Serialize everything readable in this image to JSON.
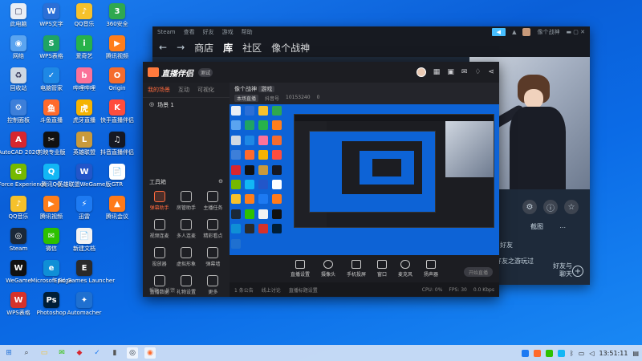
{
  "desktop": {
    "icons": [
      {
        "label": "此电脑",
        "col": 0,
        "row": 0,
        "color": "#e9eef5",
        "glyph": "▢"
      },
      {
        "label": "WPS文字",
        "col": 1,
        "row": 0,
        "color": "#2b6fd6",
        "glyph": "W"
      },
      {
        "label": "QQ音乐",
        "col": 2,
        "row": 0,
        "color": "#f6c12b",
        "glyph": "♪"
      },
      {
        "label": "360安全",
        "col": 3,
        "row": 0,
        "color": "#2fa84f",
        "glyph": "3"
      },
      {
        "label": "网络",
        "col": 0,
        "row": 1,
        "color": "#5aa4f0",
        "glyph": "◉"
      },
      {
        "label": "WPS表格",
        "col": 1,
        "row": 1,
        "color": "#1fa463",
        "glyph": "S"
      },
      {
        "label": "爱奇艺",
        "col": 2,
        "row": 1,
        "color": "#27b24a",
        "glyph": "i"
      },
      {
        "label": "腾讯视频",
        "col": 3,
        "row": 1,
        "color": "#ff7e1b",
        "glyph": "▶"
      },
      {
        "label": "回收站",
        "col": 0,
        "row": 2,
        "color": "#cfd8e3",
        "glyph": "♻"
      },
      {
        "label": "电脑管家",
        "col": 1,
        "row": 2,
        "color": "#1e88e5",
        "glyph": "✓"
      },
      {
        "label": "哔哩哔哩",
        "col": 2,
        "row": 2,
        "color": "#fb7299",
        "glyph": "b"
      },
      {
        "label": "Origin",
        "col": 3,
        "row": 2,
        "color": "#f56c2d",
        "glyph": "O"
      },
      {
        "label": "控制面板",
        "col": 0,
        "row": 3,
        "color": "#3d7fd9",
        "glyph": "⚙"
      },
      {
        "label": "斗鱼直播",
        "col": 1,
        "row": 3,
        "color": "#ff6a2b",
        "glyph": "鱼"
      },
      {
        "label": "虎牙直播",
        "col": 2,
        "row": 3,
        "color": "#f5b300",
        "glyph": "虎"
      },
      {
        "label": "快手直播伴侣",
        "col": 3,
        "row": 3,
        "color": "#ff4d3d",
        "glyph": "K"
      },
      {
        "label": "AutoCAD 2020",
        "col": 0,
        "row": 4,
        "color": "#d7262f",
        "glyph": "A"
      },
      {
        "label": "剪映专业版",
        "col": 1,
        "row": 4,
        "color": "#111111",
        "glyph": "✂"
      },
      {
        "label": "英雄联盟",
        "col": 2,
        "row": 4,
        "color": "#c99a3b",
        "glyph": "L"
      },
      {
        "label": "抖音直播伴侣",
        "col": 3,
        "row": 4,
        "color": "#161823",
        "glyph": "♫"
      },
      {
        "label": "GeForce Experience",
        "col": 0,
        "row": 5,
        "color": "#76b900",
        "glyph": "G"
      },
      {
        "label": "腾讯QQ",
        "col": 1,
        "row": 5,
        "color": "#12b7f5",
        "glyph": "Q"
      },
      {
        "label": "英雄联盟WeGame版",
        "col": 2,
        "row": 5,
        "color": "#2256c9",
        "glyph": "W"
      },
      {
        "label": "GTR",
        "col": 3,
        "row": 5,
        "color": "#ffffff",
        "glyph": "📄"
      },
      {
        "label": "QQ音乐",
        "col": 0,
        "row": 6,
        "color": "#f6c12b",
        "glyph": "♪"
      },
      {
        "label": "腾讯视频",
        "col": 1,
        "row": 6,
        "color": "#ff7e1b",
        "glyph": "▶"
      },
      {
        "label": "迅雷",
        "col": 2,
        "row": 6,
        "color": "#1d7af2",
        "glyph": "⚡"
      },
      {
        "label": "腾讯会议",
        "col": 3,
        "row": 6,
        "color": "#ff7a1a",
        "glyph": "▲"
      },
      {
        "label": "Steam",
        "col": 0,
        "row": 7,
        "color": "#1b2838",
        "glyph": "◎"
      },
      {
        "label": "微信",
        "col": 1,
        "row": 7,
        "color": "#2dc100",
        "glyph": "✉"
      },
      {
        "label": "新建文档",
        "col": 2,
        "row": 7,
        "color": "#f3f3f3",
        "glyph": "📄"
      },
      {
        "label": "WeGame",
        "col": 0,
        "row": 8,
        "color": "#111111",
        "glyph": "W"
      },
      {
        "label": "Microsoft Edge",
        "col": 1,
        "row": 8,
        "color": "#0f8fd6",
        "glyph": "e"
      },
      {
        "label": "Epic Games Launcher",
        "col": 2,
        "row": 8,
        "color": "#2a2a2a",
        "glyph": "E"
      },
      {
        "label": "WPS表格",
        "col": 0,
        "row": 9,
        "color": "#d6322a",
        "glyph": "W"
      },
      {
        "label": "Photoshop",
        "col": 1,
        "row": 9,
        "color": "#001e36",
        "glyph": "Ps"
      },
      {
        "label": "Automacher",
        "col": 2,
        "row": 9,
        "color": "#1f70d0",
        "glyph": "✦"
      }
    ]
  },
  "steam": {
    "top_items": [
      "Steam",
      "查看",
      "好友",
      "游戏",
      "帮助"
    ],
    "user_label": "像个战神",
    "nav": {
      "back": "←",
      "forward": "→",
      "store": "商店",
      "library": "库",
      "community": "社区",
      "profile": "像个战神"
    },
    "right_texts": {
      "friends_text": "好友",
      "activity": "好友之游玩过",
      "media": "截图",
      "more": "..."
    },
    "friends_chat": {
      "line1": "好友与",
      "line2": "聊天"
    }
  },
  "live": {
    "app_name": "直播伴侣",
    "version": "测试",
    "side_tabs": [
      "我的场景",
      "互动",
      "可视化"
    ],
    "scene": {
      "icon": "◎",
      "label": "场景 1"
    },
    "tools_title": "工具箱",
    "tools": [
      {
        "label": "弹幕助手",
        "hot": true
      },
      {
        "label": "房管助手",
        "hot": false
      },
      {
        "label": "主播任务",
        "hot": false
      },
      {
        "label": "视频连麦",
        "hot": false
      },
      {
        "label": "多人连麦",
        "hot": false
      },
      {
        "label": "精彩看点",
        "hot": false
      },
      {
        "label": "投放器",
        "hot": false
      },
      {
        "label": "虚拟形象",
        "hot": false
      },
      {
        "label": "弹幕墙",
        "hot": false
      },
      {
        "label": "直播数据",
        "hot": false
      },
      {
        "label": "礼物设置",
        "hot": false
      },
      {
        "label": "更多",
        "hot": false
      }
    ],
    "room": {
      "title": "像个战神",
      "tag": "游戏",
      "sub1": "本场直播",
      "sub2": "抖音号",
      "sub3": "10153240",
      "likes": "0"
    },
    "bottom_buttons": [
      "直播设置",
      "摄像头",
      "手机投屏",
      "窗口",
      "麦克风",
      "扬声器"
    ],
    "start_live": "开始直播",
    "status": {
      "left": "1 条公告",
      "mid": "线上讨论",
      "mid2": "直播标题设置",
      "right1": "CPU: 0%",
      "right2": "FPS: 30",
      "right3": "0.0 Kbps"
    },
    "side_status": [
      "帮助",
      "反馈"
    ]
  },
  "taskbar": {
    "time": "13:51:11",
    "icons": [
      {
        "name": "start",
        "glyph": "⊞",
        "color": "#1f6fd6"
      },
      {
        "name": "search",
        "glyph": "⌕",
        "color": "#333"
      },
      {
        "name": "file-explorer",
        "glyph": "▭",
        "color": "#f6c12b"
      },
      {
        "name": "wechat",
        "glyph": "✉",
        "color": "#2dc100"
      },
      {
        "name": "app-red",
        "glyph": "◆",
        "color": "#d7262f"
      },
      {
        "name": "app-check",
        "glyph": "✓",
        "color": "#1d7af2"
      },
      {
        "name": "app-grey",
        "glyph": "▮",
        "color": "#555"
      },
      {
        "name": "steam",
        "glyph": "◎",
        "color": "#1b2838",
        "active": true
      },
      {
        "name": "live",
        "glyph": "◉",
        "color": "#ff6a2b",
        "active": true
      }
    ]
  }
}
